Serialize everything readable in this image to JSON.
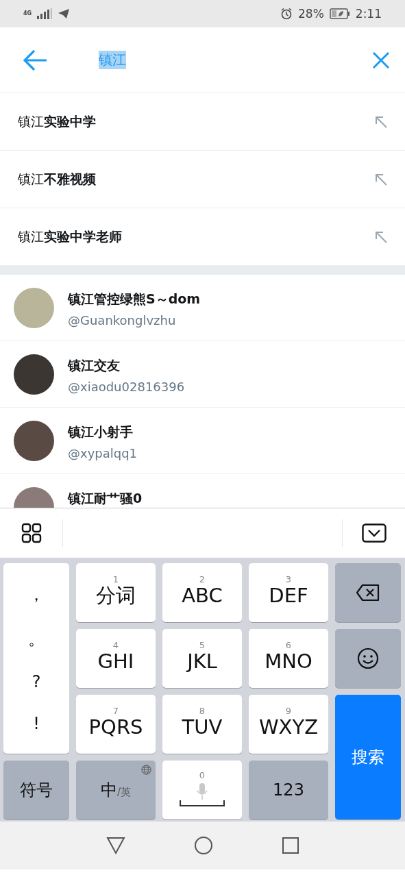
{
  "status_bar": {
    "network": "4G",
    "battery": "28%",
    "time": "2:11"
  },
  "search": {
    "value": "镇江",
    "text_selected": true
  },
  "suggestions": [
    {
      "text": "镇江**实验中学**"
    },
    {
      "text": "镇江**不雅视频**"
    },
    {
      "text": "镇江**实验中学老师**"
    }
  ],
  "users": [
    {
      "name": "镇江管控绿熊S～dom",
      "handle": "@Guankonglvzhu"
    },
    {
      "name": "镇江交友",
      "handle": "@xiaodu02816396"
    },
    {
      "name": "镇江小射手",
      "handle": "@xypalqq1"
    },
    {
      "name": "镇江耐艹骚0"
    }
  ],
  "keyboard": {
    "keys": [
      {
        "kind": "punct",
        "chars": [
          "，",
          "。",
          "?",
          "!"
        ]
      },
      {
        "kind": "t9",
        "number": "1",
        "label": "分词"
      },
      {
        "kind": "t9",
        "number": "2",
        "label": "ABC"
      },
      {
        "kind": "t9",
        "number": "3",
        "label": "DEF"
      },
      {
        "kind": "backspace"
      },
      {
        "kind": "t9",
        "number": "4",
        "label": "GHI"
      },
      {
        "kind": "t9",
        "number": "5",
        "label": "JKL"
      },
      {
        "kind": "t9",
        "number": "6",
        "label": "MNO"
      },
      {
        "kind": "emoji"
      },
      {
        "kind": "t9",
        "number": "7",
        "label": "PQRS"
      },
      {
        "kind": "t9",
        "number": "8",
        "label": "TUV"
      },
      {
        "kind": "t9",
        "number": "9",
        "label": "WXYZ"
      },
      {
        "kind": "search",
        "label": "搜索"
      },
      {
        "kind": "function",
        "label": "符号"
      },
      {
        "kind": "lang",
        "label": "中",
        "sublabel": "/英"
      },
      {
        "kind": "space",
        "number": "0"
      },
      {
        "kind": "function",
        "label": "123"
      }
    ]
  }
}
